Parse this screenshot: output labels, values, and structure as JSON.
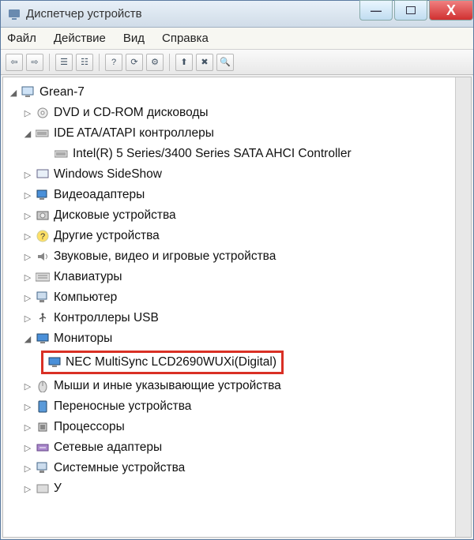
{
  "window": {
    "title": "Диспетчер устройств"
  },
  "menu": {
    "file": "Файл",
    "action": "Действие",
    "view": "Вид",
    "help": "Справка"
  },
  "tree": {
    "root": "Grean-7",
    "dvd": "DVD и CD-ROM дисководы",
    "ide": "IDE ATA/ATAPI контроллеры",
    "ide_child": "Intel(R) 5 Series/3400 Series SATA AHCI Controller",
    "sideshow": "Windows SideShow",
    "video": "Видеоадаптеры",
    "disk": "Дисковые устройства",
    "other": "Другие устройства",
    "audio": "Звуковые, видео и игровые устройства",
    "keyboard": "Клавиатуры",
    "computer": "Компьютер",
    "usb": "Контроллеры USB",
    "monitors": "Мониторы",
    "monitor_child": "NEC MultiSync LCD2690WUXi(Digital)",
    "mouse": "Мыши и иные указывающие устройства",
    "portable": "Переносные устройства",
    "cpu": "Процессоры",
    "network": "Сетевые адаптеры",
    "system": "Системные устройства",
    "hid_partial": "У"
  }
}
